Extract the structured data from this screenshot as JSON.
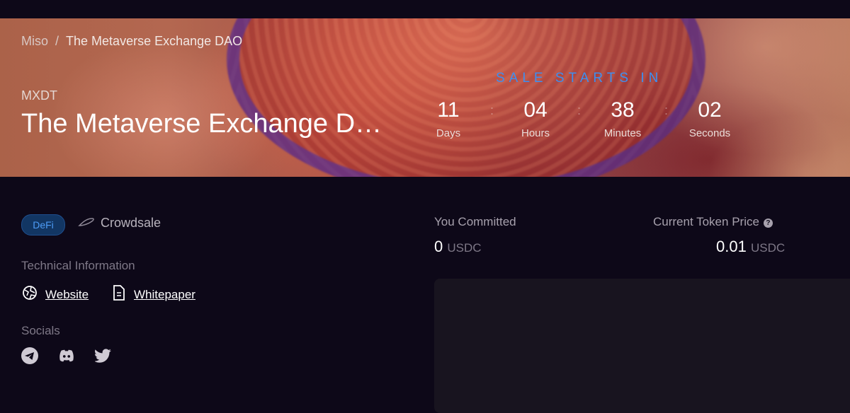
{
  "breadcrumb": {
    "root": "Miso",
    "separator": "/",
    "current": "The Metaverse Exchange DAO"
  },
  "token": {
    "symbol": "MXDT",
    "title": "The Metaverse Exchange DA..."
  },
  "sale": {
    "label": "SALE STARTS IN",
    "countdown": [
      {
        "value": "11",
        "label": "Days"
      },
      {
        "value": "04",
        "label": "Hours"
      },
      {
        "value": "38",
        "label": "Minutes"
      },
      {
        "value": "02",
        "label": "Seconds"
      }
    ],
    "separator": ":"
  },
  "tags": {
    "category": "DeFi",
    "type": "Crowdsale"
  },
  "technical": {
    "heading": "Technical Information",
    "website": "Website",
    "whitepaper": "Whitepaper"
  },
  "socials": {
    "heading": "Socials",
    "icons": [
      "telegram-icon",
      "discord-icon",
      "twitter-icon"
    ]
  },
  "stats": {
    "committed_label": "You Committed",
    "committed_value": "0",
    "committed_unit": "USDC",
    "price_label": "Current Token Price",
    "price_value": "0.01",
    "price_unit": "USDC"
  },
  "colors": {
    "background": "#0d0818",
    "accent": "#3d8ff0",
    "tag_bg": "#123663"
  }
}
